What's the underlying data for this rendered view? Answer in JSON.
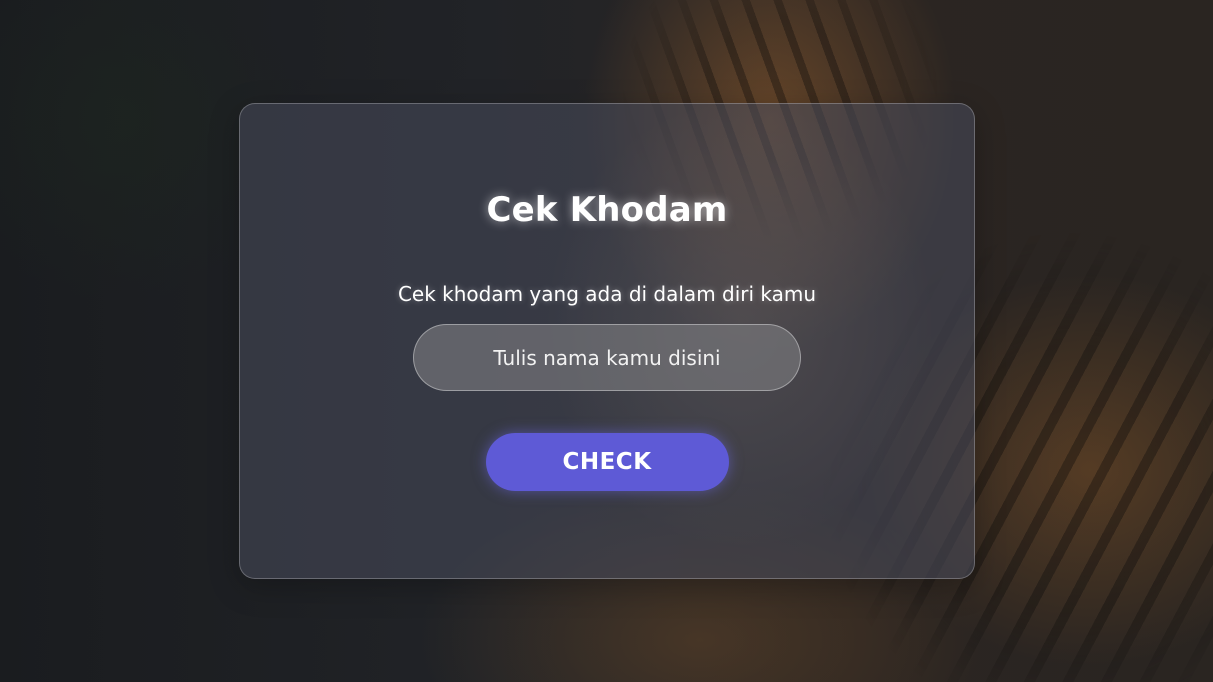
{
  "colors": {
    "accent": "#5e5ad6",
    "card_background": "rgba(72,76,92,0.55)",
    "text": "#ffffff"
  },
  "background": {
    "image": "tiger-photo"
  },
  "card": {
    "title": "Cek Khodam",
    "subtitle": "Cek khodam yang ada di dalam diri kamu",
    "name_input": {
      "value": "",
      "placeholder": "Tulis nama kamu disini"
    },
    "check_button_label": "CHECK"
  }
}
